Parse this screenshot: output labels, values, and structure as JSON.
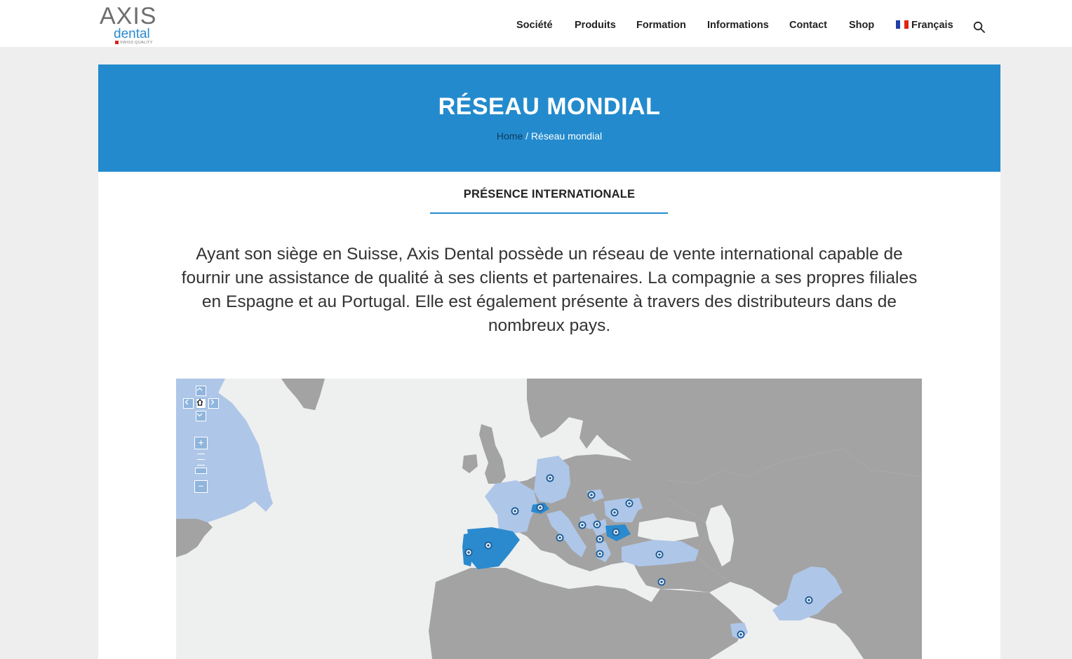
{
  "header": {
    "logo": {
      "brand": "AXIS",
      "sub": "dental",
      "tagline": "SWISS QUALITY"
    },
    "nav": [
      {
        "label": "Société"
      },
      {
        "label": "Produits"
      },
      {
        "label": "Formation"
      },
      {
        "label": "Informations"
      },
      {
        "label": "Contact"
      },
      {
        "label": "Shop"
      }
    ],
    "language": {
      "label": "Français",
      "flag_icon": "france-flag-icon"
    },
    "search_icon": "search-icon"
  },
  "hero": {
    "title": "RÉSEAU MONDIAL",
    "breadcrumb": {
      "home": "Home",
      "separator": "/",
      "current": "Réseau mondial"
    },
    "bg_color": "#238bcd"
  },
  "section": {
    "title": "PRÉSENCE INTERNATIONALE",
    "intro": "Ayant son siège en Suisse, Axis Dental possède un réseau de vente international capable de fournir une assistance de qualité à ses clients et partenaires. La compagnie a ses propres filiales en Espagne et au Portugal. Elle est également présente à travers des distributeurs dans de nombreux pays."
  },
  "map": {
    "controls": {
      "pan_up": "chevron-up-icon",
      "pan_left": "chevron-left-icon",
      "home": "home-icon",
      "pan_right": "chevron-right-icon",
      "pan_down": "chevron-down-icon",
      "zoom_in": "+",
      "zoom_out": "−"
    },
    "colors": {
      "water": "#eeefef",
      "land": "#a3a3a3",
      "distributor": "#aec6e8",
      "subsidiary": "#2b8ace",
      "marker": "#1f5e9a"
    }
  }
}
